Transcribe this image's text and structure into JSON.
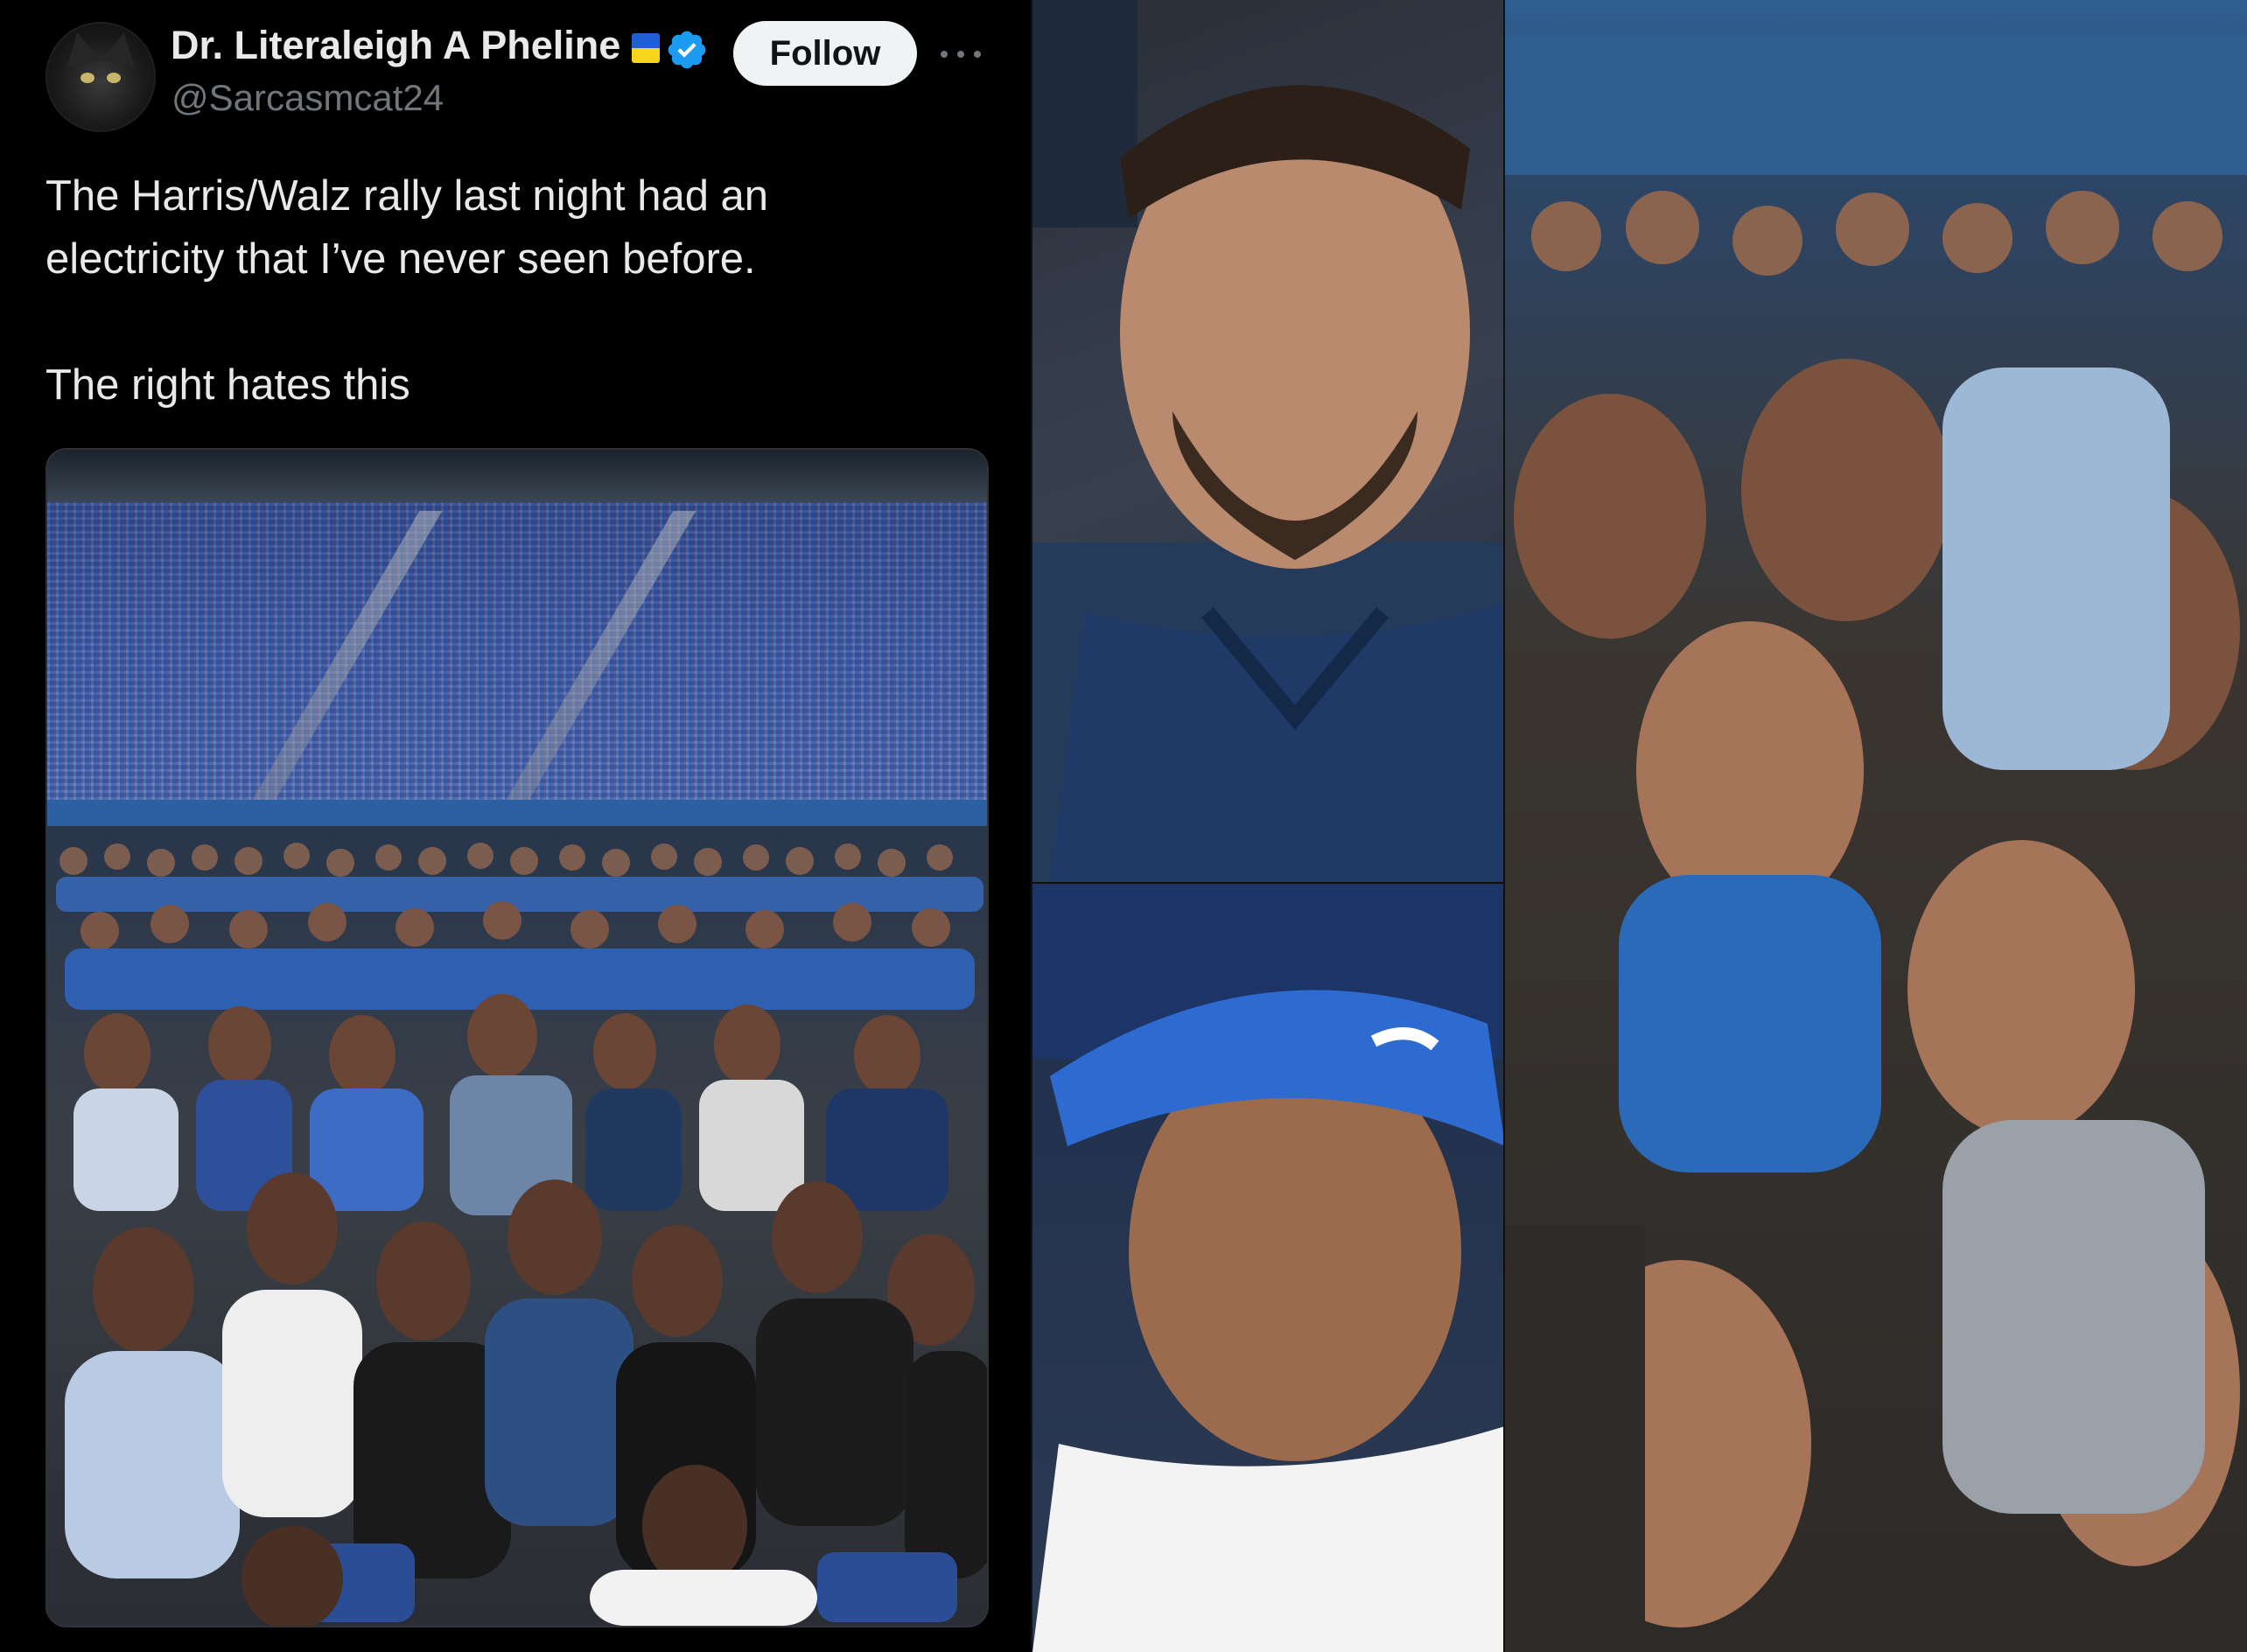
{
  "tweet": {
    "display_name": "Dr. Literaleigh A Pheline",
    "handle": "@Sarcasmcat24",
    "follow_label": "Follow",
    "text_line1": "The Harris/Walz rally last night had an",
    "text_line2": "electricity that I’ve never seen before.",
    "text_line3": "The right hates this",
    "icons": {
      "avatar": "black-cat-avatar",
      "flag": "ukraine-flag-icon",
      "verified": "verified-badge-icon",
      "more": "more-options-icon"
    }
  },
  "colors": {
    "background": "#000000",
    "name_text": "#e7e9ea",
    "handle_text": "#71767b",
    "follow_bg": "#eff3f4",
    "verified_blue": "#1d9bf0",
    "flag_blue": "#1f5fd6",
    "flag_yellow": "#f7d51d"
  },
  "media": {
    "main_photo": "stadium rally crowd photo",
    "zoom_photos": [
      "zoomed crowd face 1",
      "zoomed crowd face 2",
      "zoomed crowd strip"
    ]
  }
}
